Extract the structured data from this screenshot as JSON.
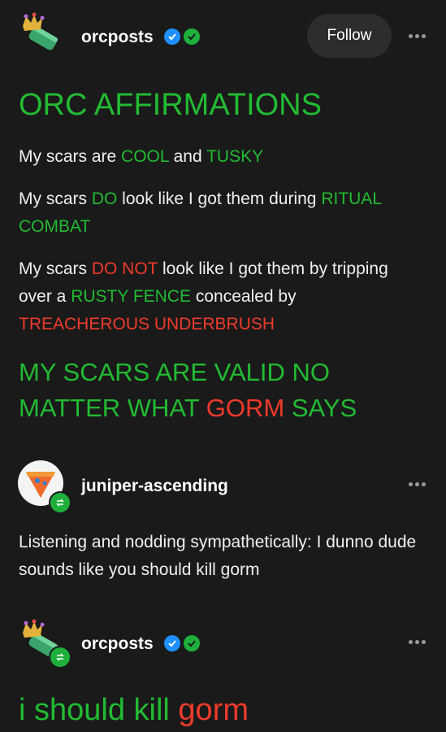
{
  "posts": [
    {
      "username": "orcposts",
      "follow_label": "Follow",
      "title": "ORC AFFIRMATIONS",
      "p1": {
        "a": "My scars are ",
        "b": "COOL",
        "c": " and ",
        "d": "TUSKY"
      },
      "p2": {
        "a": "My scars ",
        "b": "DO",
        "c": " look like I got them during ",
        "d": "RITUAL COMBAT"
      },
      "p3": {
        "a": "My scars ",
        "b": "DO NOT",
        "c": " look like I got them by tripping over a ",
        "d": "RUSTY FENCE",
        "e": " concealed by ",
        "f": "TREACHEROUS UNDERBRUSH"
      },
      "p4": {
        "a": "MY SCARS ARE VALID NO MATTER WHAT ",
        "b": "GORM",
        "c": " SAYS"
      }
    },
    {
      "username": "juniper-ascending",
      "body": "Listening and nodding sympathetically: I dunno dude sounds like you should kill gorm"
    },
    {
      "username": "orcposts",
      "body": {
        "a": "i should kill ",
        "b": "gorm"
      }
    }
  ],
  "colors": {
    "green": "#22bb33",
    "red": "#ef3b2c",
    "badge_blue": "#1e90ff",
    "badge_green": "#1fb03c"
  }
}
